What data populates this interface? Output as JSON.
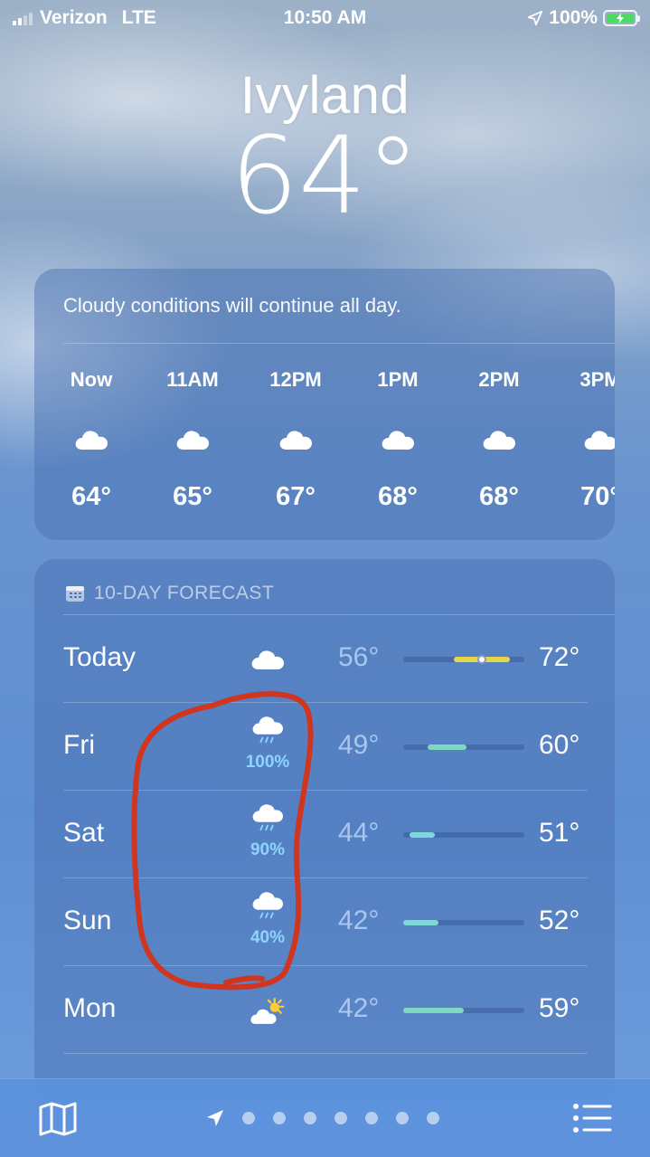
{
  "status_bar": {
    "carrier": "Verizon",
    "network": "LTE",
    "time": "10:50 AM",
    "battery": "100%"
  },
  "location": {
    "city": "Ivyland",
    "current_temp": "64°"
  },
  "hourly": {
    "summary": "Cloudy conditions will continue all day.",
    "items": [
      {
        "time": "Now",
        "icon": "cloud-icon",
        "temp": "64°"
      },
      {
        "time": "11AM",
        "icon": "cloud-icon",
        "temp": "65°"
      },
      {
        "time": "12PM",
        "icon": "cloud-icon",
        "temp": "67°"
      },
      {
        "time": "1PM",
        "icon": "cloud-icon",
        "temp": "68°"
      },
      {
        "time": "2PM",
        "icon": "cloud-icon",
        "temp": "68°"
      },
      {
        "time": "3PM",
        "icon": "cloud-icon",
        "temp": "70°"
      }
    ]
  },
  "forecast": {
    "header": "10-DAY FORECAST",
    "days": [
      {
        "day": "Today",
        "icon": "cloud-icon",
        "precip": "",
        "low": "56°",
        "high": "72°",
        "bar_start": 0.42,
        "bar_end": 0.88,
        "bar_color": "#e6d64a",
        "current_marker": 0.65
      },
      {
        "day": "Fri",
        "icon": "cloud-rain-icon",
        "precip": "100%",
        "low": "49°",
        "high": "60°",
        "bar_start": 0.2,
        "bar_end": 0.52,
        "bar_color": "#7fd8c4"
      },
      {
        "day": "Sat",
        "icon": "cloud-rain-icon",
        "precip": "90%",
        "low": "44°",
        "high": "51°",
        "bar_start": 0.05,
        "bar_end": 0.26,
        "bar_color": "#7fd8d8"
      },
      {
        "day": "Sun",
        "icon": "cloud-rain-icon",
        "precip": "40%",
        "low": "42°",
        "high": "52°",
        "bar_start": 0.0,
        "bar_end": 0.29,
        "bar_color": "#7fd8d8"
      },
      {
        "day": "Mon",
        "icon": "partly-sunny-icon",
        "precip": "",
        "low": "42°",
        "high": "59°",
        "bar_start": 0.0,
        "bar_end": 0.5,
        "bar_color": "#7fd8c4"
      }
    ]
  },
  "tab_bar": {
    "page_count": 7,
    "active_page": 0
  },
  "colors": {
    "accent_precip": "#8fd3ff",
    "annotation": "#d0361f",
    "sun": "#ffcc33"
  }
}
